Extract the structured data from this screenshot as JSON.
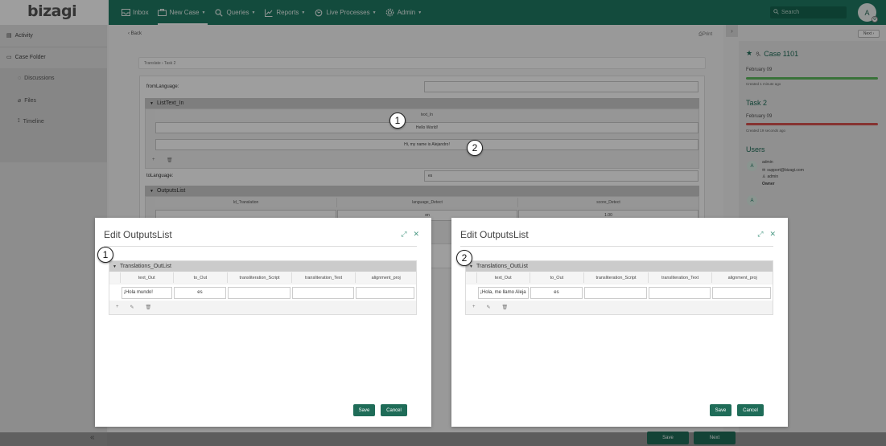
{
  "app": {
    "logo": "bizagi"
  },
  "nav": {
    "items": [
      {
        "label": "Inbox",
        "icon": "inbox-icon"
      },
      {
        "label": "New Case",
        "icon": "briefcase-icon"
      },
      {
        "label": "Queries",
        "icon": "search-icon"
      },
      {
        "label": "Reports",
        "icon": "chart-icon"
      },
      {
        "label": "Live Processes",
        "icon": "refresh-icon"
      },
      {
        "label": "Admin",
        "icon": "gear-icon"
      }
    ],
    "active": "New Case",
    "search_placeholder": "Search",
    "avatar_letter": "A"
  },
  "sidebar": {
    "items": [
      {
        "label": "Activity",
        "icon": "activity-icon"
      },
      {
        "label": "Case Folder",
        "icon": "folder-icon"
      },
      {
        "label": "Discussions",
        "icon": "chat-icon"
      },
      {
        "label": "Files",
        "icon": "paperclip-icon"
      },
      {
        "label": "Timeline",
        "icon": "timeline-icon"
      }
    ]
  },
  "main": {
    "back_label": "Back",
    "print_label": "Print",
    "breadcrumb": "Translate › Task 2",
    "form": {
      "from_language_label": "fromLanguage:",
      "from_language_value": "",
      "listtext_title": "ListText_In",
      "listtext_column": "text_In",
      "listtext_rows": [
        "Hello World!",
        "Hi, my name is Alejandro!"
      ],
      "to_language_label": "toLanguage:",
      "to_language_value": "es",
      "outputs_title": "OutputsList",
      "outputs_columns": [
        "Id_Translation",
        "language_Detect",
        "score_Detect"
      ],
      "outputs_row": {
        "language_detect": "en",
        "score_detect": "1.00"
      }
    }
  },
  "right_panel": {
    "next_top": "Next",
    "case_title": "Case 1101",
    "case_date": "February 09",
    "case_created": "Created 1 minute ago",
    "task_title": "Task 2",
    "task_date": "February 09",
    "task_created": "Created 19 seconds ago",
    "users_title": "Users",
    "user": {
      "avatar": "A",
      "name": "admin",
      "email": "support@bizagi.com",
      "login": "admin",
      "role": "Owner"
    },
    "user2_avatar": "A",
    "colors": {
      "case_bar": "#5cb85c",
      "task_bar": "#d9534f"
    }
  },
  "bottom": {
    "save": "Save",
    "next": "Next"
  },
  "callouts": [
    "1",
    "2",
    "1",
    "2"
  ],
  "modal_left": {
    "title": "Edit OutputsList",
    "grid_title": "Translations_OutList",
    "columns": [
      "text_Out",
      "to_Out",
      "transliteration_Script",
      "transliteration_Text",
      "alignment_proj"
    ],
    "row": {
      "text_out": "¡Hola mundo!",
      "to_out": "es",
      "script": "",
      "text": "",
      "alignment": ""
    },
    "save": "Save",
    "cancel": "Cancel"
  },
  "modal_right": {
    "title": "Edit OutputsList",
    "grid_title": "Translations_OutList",
    "columns": [
      "text_Out",
      "to_Out",
      "transliteration_Script",
      "transliteration_Text",
      "alignment_proj"
    ],
    "row": {
      "text_out": "¡Hola, me llamo Aleja",
      "to_out": "es",
      "script": "",
      "text": "",
      "alignment": ""
    },
    "save": "Save",
    "cancel": "Cancel"
  }
}
